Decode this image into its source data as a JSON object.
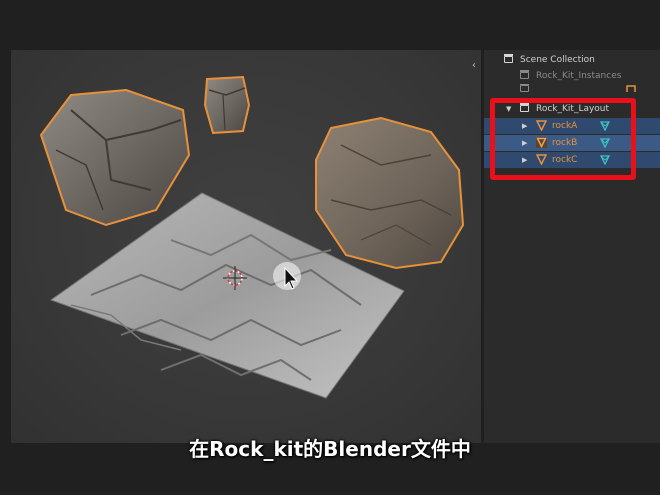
{
  "outliner": {
    "scene_collection": "Scene Collection",
    "instances_collection": "Rock_Kit_Instances",
    "hidden_collection": "",
    "layout_collection": "Rock_Kit_Layout",
    "objects": [
      {
        "name": "rockA",
        "state": "selected"
      },
      {
        "name": "rockB",
        "state": "active"
      },
      {
        "name": "rockC",
        "state": "selected"
      }
    ]
  },
  "icons": {
    "scene_collection": "collection-icon",
    "collection": "collection-icon",
    "object": "mesh-object-icon",
    "object_data": "mesh-data-icon",
    "expand": "triangle-right-icon",
    "collapse": "triangle-down-icon",
    "sidebar_toggle": "chevron-left-icon"
  },
  "colors": {
    "selection_outline": "#e8913a",
    "highlight_box": "#e8101b",
    "row_selected": "#2f4a6e",
    "row_active": "#3c5a86"
  },
  "caption": "在Rock_kit的Blender文件中"
}
